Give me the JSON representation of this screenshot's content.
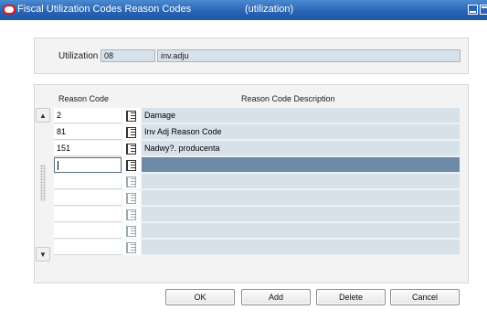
{
  "window": {
    "title": "Fiscal Utilization Codes Reason Codes",
    "subtitle": "(utilization)"
  },
  "utilization": {
    "label": "Utilization",
    "code": "08",
    "description": "inv.adju"
  },
  "table": {
    "headers": [
      "Reason Code",
      "Reason Code Description"
    ],
    "rows": [
      {
        "code": "2",
        "description": "Damage"
      },
      {
        "code": "81",
        "description": "Inv Adj Reason Code"
      },
      {
        "code": "151",
        "description": "Nadwy?. producenta"
      },
      {
        "code": "",
        "description": ""
      },
      {
        "code": "",
        "description": ""
      },
      {
        "code": "",
        "description": ""
      },
      {
        "code": "",
        "description": ""
      },
      {
        "code": "",
        "description": ""
      },
      {
        "code": "",
        "description": ""
      }
    ],
    "selected_row": 3
  },
  "buttons": {
    "ok": "OK",
    "add": "Add",
    "delete": "Delete",
    "cancel": "Cancel"
  },
  "icons": {
    "app": "oracle-icon",
    "row_lookup": "list-of-values-icon"
  }
}
